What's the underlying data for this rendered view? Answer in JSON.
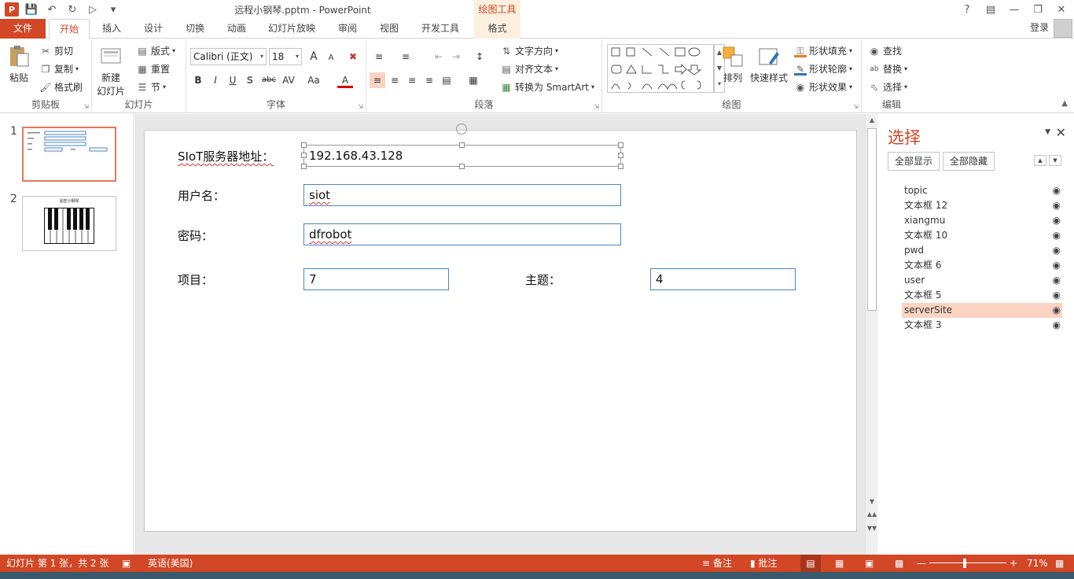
{
  "app": {
    "title": "远程小钢琴.pptm - PowerPoint",
    "contextual_label": "绘图工具",
    "login": "登录",
    "logo_letter": "P"
  },
  "tabs": [
    "文件",
    "开始",
    "插入",
    "设计",
    "切换",
    "动画",
    "幻灯片放映",
    "审阅",
    "视图",
    "开发工具",
    "格式"
  ],
  "ribbon": {
    "clipboard": {
      "label": "剪贴板",
      "paste": "粘贴",
      "cut": "剪切",
      "copy": "复制",
      "format_painter": "格式刷"
    },
    "slides": {
      "label": "幻灯片",
      "new_slide_1": "新建",
      "new_slide_2": "幻灯片",
      "layout": "版式",
      "reset": "重置",
      "section": "节"
    },
    "font": {
      "label": "字体",
      "font_name": "Calibri (正文)",
      "font_size": "18",
      "bold": "B",
      "italic": "I",
      "underline": "U",
      "shadow": "S",
      "strike": "abc",
      "spacing": "AV",
      "case": "Aa",
      "color": "A",
      "grow": "A",
      "shrink": "A"
    },
    "paragraph": {
      "label": "段落",
      "text_direction": "文字方向",
      "align_text": "对齐文本",
      "smartart": "转换为 SmartArt"
    },
    "drawing": {
      "label": "绘图",
      "arrange": "排列",
      "quick_styles": "快速样式",
      "shape_fill": "形状填充",
      "shape_outline": "形状轮廓",
      "shape_effects": "形状效果"
    },
    "editing": {
      "label": "编辑",
      "find": "查找",
      "replace": "替换",
      "select": "选择"
    }
  },
  "thumbnails": [
    {
      "number": "1"
    },
    {
      "number": "2",
      "title": "遥控小钢琴"
    }
  ],
  "slide": {
    "labels": {
      "server": "SIoT服务器地址：",
      "user": "用户名：",
      "password": "密码：",
      "project": "项目：",
      "topic": "主题："
    },
    "fields": {
      "server": "192.168.43.128",
      "user": "siot",
      "password": "dfrobot",
      "project": "7",
      "topic": "4"
    }
  },
  "selection_pane": {
    "title": "选择",
    "show_all": "全部显示",
    "hide_all": "全部隐藏",
    "items": [
      "topic",
      "文本框 12",
      "xiangmu",
      "文本框 10",
      "pwd",
      "文本框 6",
      "user",
      "文本框 5",
      "serverSite",
      "文本框 3"
    ],
    "selected_index": 8
  },
  "status": {
    "slide_info": "幻灯片 第 1 张，共 2 张",
    "language": "英语(美国)",
    "notes": "备注",
    "comments": "批注",
    "zoom": "71%",
    "zoom_level": 0.46
  },
  "colors": {
    "accent": "#d24726",
    "selection": "#fbd3c2",
    "field_border": "#4a86c5"
  }
}
